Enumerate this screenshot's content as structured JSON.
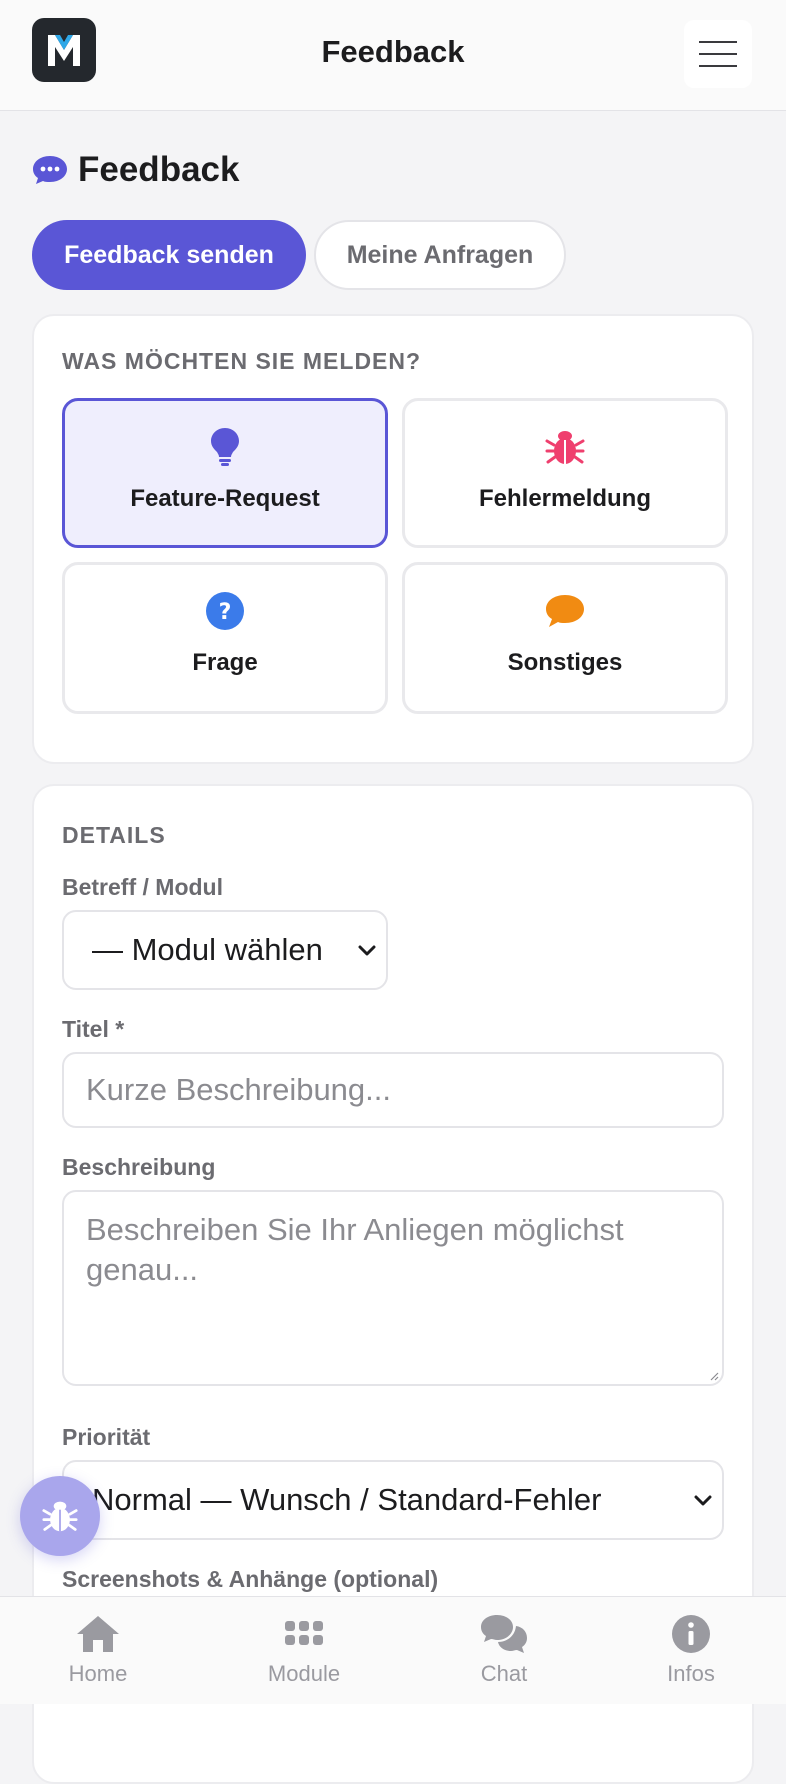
{
  "colors": {
    "accent": "#5a56d6",
    "bug": "#ef3f6e",
    "question": "#3b7bea",
    "other": "#f18b12"
  },
  "header": {
    "title": "Feedback",
    "logo_letter": "M"
  },
  "page": {
    "title": "Feedback"
  },
  "tabs": [
    {
      "label": "Feedback senden",
      "active": true
    },
    {
      "label": "Meine Anfragen",
      "active": false
    }
  ],
  "type_section": {
    "label": "WAS MÖCHTEN SIE MELDEN?",
    "options": [
      {
        "label": "Feature-Request",
        "icon": "lightbulb-icon",
        "selected": true
      },
      {
        "label": "Fehlermeldung",
        "icon": "bug-icon",
        "selected": false
      },
      {
        "label": "Frage",
        "icon": "question-icon",
        "selected": false
      },
      {
        "label": "Sonstiges",
        "icon": "speech-bubble-icon",
        "selected": false
      }
    ]
  },
  "details": {
    "label": "DETAILS",
    "module_label": "Betreff / Modul",
    "module_value": "— Modul wählen",
    "title_label": "Titel *",
    "title_placeholder": "Kurze Beschreibung...",
    "description_label": "Beschreibung",
    "description_placeholder": "Beschreiben Sie Ihr Anliegen möglichst genau...",
    "priority_label": "Priorität",
    "priority_value": "Normal — Wunsch / Standard-Fehler",
    "attachments_label": "Screenshots & Anhänge (optional)"
  },
  "bottom_nav": [
    {
      "label": "Home",
      "icon": "home-icon"
    },
    {
      "label": "Module",
      "icon": "grid-icon"
    },
    {
      "label": "Chat",
      "icon": "chat-icon"
    },
    {
      "label": "Infos",
      "icon": "info-icon"
    }
  ]
}
